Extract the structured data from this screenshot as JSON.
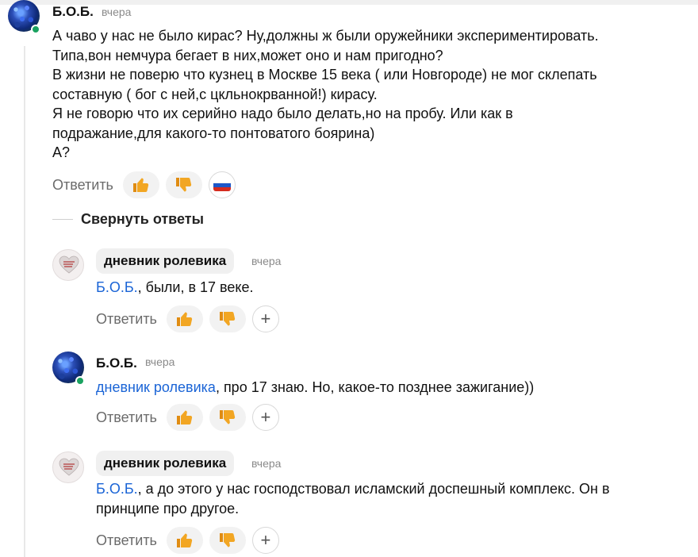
{
  "comments": [
    {
      "author": "Б.О.Б.",
      "time": "вчера",
      "lines": [
        "А чаво у нас не было кирас? Ну,должны ж были оружейники экспериментировать.",
        "Типа,вон немчура бегает в них,может оно и нам пригодно?",
        "В жизни не поверю что кузнец в Москве 15 века ( или Новгороде) не мог склепать",
        "составную ( бог с ней,с цкльнокрванной!) кирасу.",
        "Я не говорю что их серийно надо было делать,но на пробу. Или как в",
        "подражание,для какого-то понтоватого боярина)",
        "А?"
      ],
      "reply_label": "Ответить"
    },
    {
      "author": "дневник ролевика",
      "time": "вчера",
      "mention": "Б.О.Б.",
      "text": ", были, в 17 веке.",
      "reply_label": "Ответить"
    },
    {
      "author": "Б.О.Б.",
      "time": "вчера",
      "mention": "дневник ролевика",
      "text": ", про 17 знаю. Но, какое-то позднее зажигание))",
      "reply_label": "Ответить"
    },
    {
      "author": "дневник ролевика",
      "time": "вчера",
      "mention": "Б.О.Б.",
      "text_line1": ", а до этого у нас господствовал исламский доспешный комплекс. Он в",
      "text_line2": "принципе про другое.",
      "reply_label": "Ответить"
    }
  ],
  "collapse_label": "Свернуть ответы",
  "add_reaction_symbol": "+",
  "icons": {
    "like": "thumbs-up-icon",
    "dislike": "thumbs-down-icon",
    "flag": "russia-flag-icon",
    "add": "plus-icon"
  },
  "colors": {
    "mention": "#1a64d6",
    "online": "#1aa260",
    "thumb": "#f2a623"
  }
}
